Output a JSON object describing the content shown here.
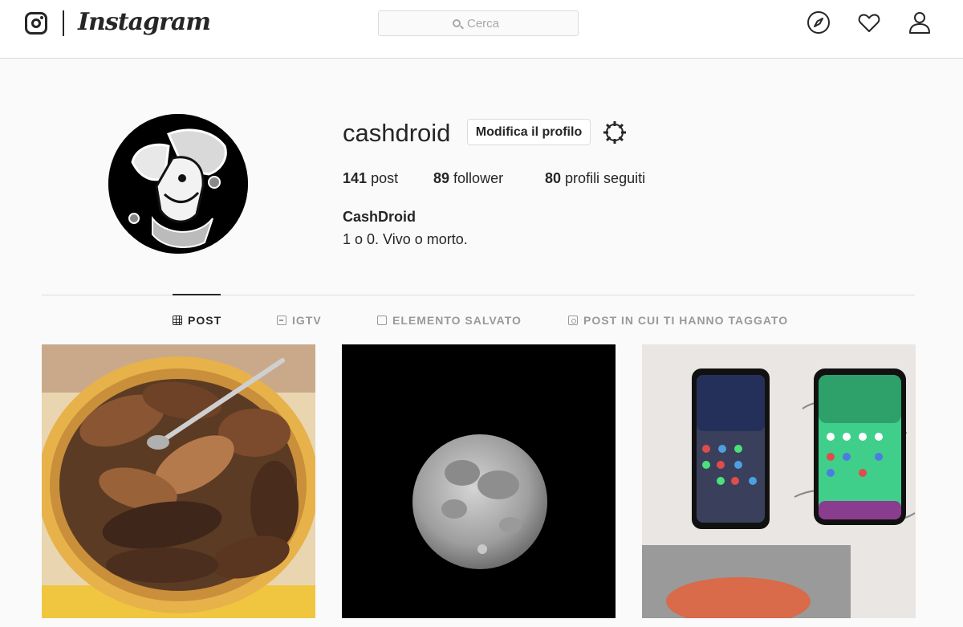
{
  "app": {
    "wordmark": "Instagram"
  },
  "search": {
    "placeholder": "Cerca"
  },
  "nav_icons": [
    "compass-icon",
    "heart-icon",
    "person-icon"
  ],
  "profile": {
    "username": "cashdroid",
    "edit_button": "Modifica il profilo",
    "stats": {
      "posts_count": "141",
      "posts_label": "post",
      "followers_count": "89",
      "followers_label": "follower",
      "following_count": "80",
      "following_label": "profili seguiti"
    },
    "full_name": "CashDroid",
    "bio": "1 o 0. Vivo o morto."
  },
  "tabs": [
    {
      "label": "POST",
      "icon": "grid-icon",
      "active": true
    },
    {
      "label": "IGTV",
      "icon": "igtv-icon",
      "active": false
    },
    {
      "label": "ELEMENTO SALVATO",
      "icon": "bookmark-icon",
      "active": false
    },
    {
      "label": "POST IN CUI TI HANNO TAGGATO",
      "icon": "tag-icon",
      "active": false
    }
  ],
  "posts": [
    {
      "subject": "grilled meat platter"
    },
    {
      "subject": "full moon"
    },
    {
      "subject": "two smartphones"
    }
  ],
  "colors": {
    "text": "#262626",
    "muted": "#999999",
    "border": "#dbdbdb",
    "background": "#fafafa"
  }
}
